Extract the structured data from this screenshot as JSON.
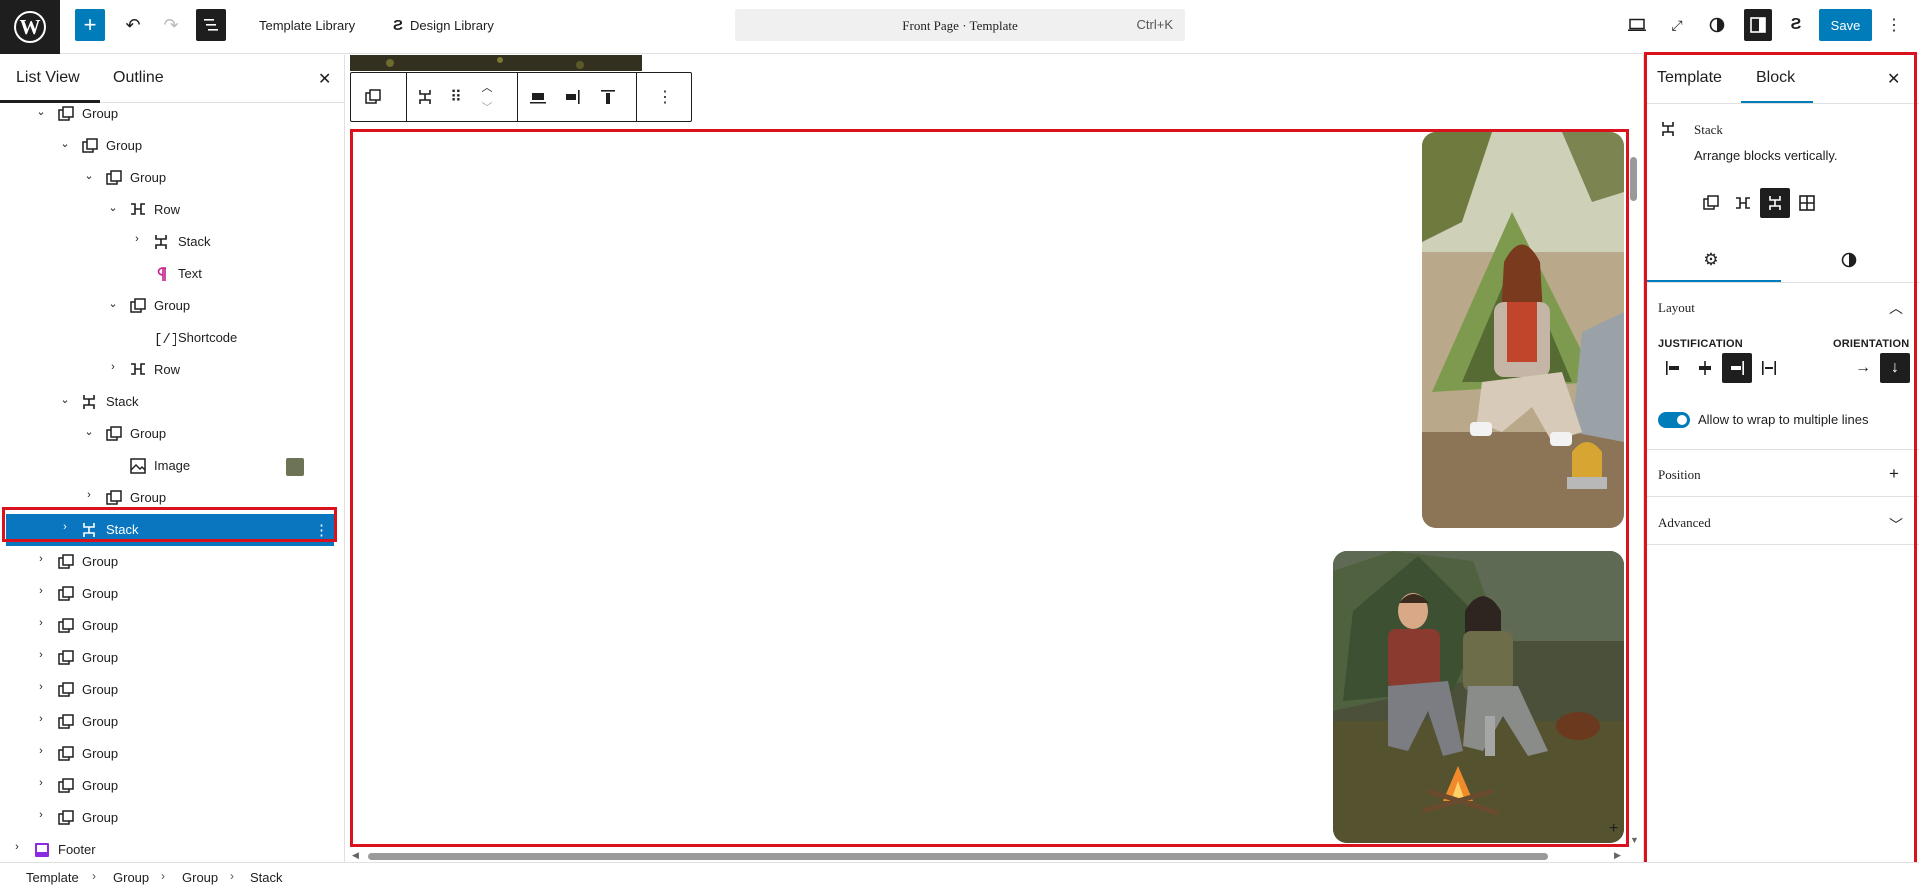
{
  "topbar": {
    "plus_label": "+",
    "undo": "↶",
    "redo": "↷",
    "template_library": "Template Library",
    "design_library": "Design Library",
    "command_title": "Front Page · Template",
    "command_shortcut": "Ctrl+K",
    "save_label": "Save"
  },
  "left_panel": {
    "tabs": [
      "List View",
      "Outline"
    ],
    "close": "✕",
    "rows": [
      {
        "label": "Group",
        "icon": "group-icon",
        "expanded": true
      },
      {
        "label": "Group",
        "icon": "group-icon",
        "expanded": true
      },
      {
        "label": "Group",
        "icon": "group-icon",
        "expanded": true
      },
      {
        "label": "Row",
        "icon": "row-icon",
        "expanded": true
      },
      {
        "label": "Stack",
        "icon": "stack-icon",
        "expanded": false
      },
      {
        "label": "Text",
        "icon": "paragraph-icon"
      },
      {
        "label": "Group",
        "icon": "group-icon",
        "expanded": true
      },
      {
        "label": "Shortcode",
        "icon": "shortcode-icon"
      },
      {
        "label": "Row",
        "icon": "row-icon",
        "expanded": false
      },
      {
        "label": "Stack",
        "icon": "stack-icon",
        "expanded": true
      },
      {
        "label": "Group",
        "icon": "group-icon",
        "expanded": true
      },
      {
        "label": "Image",
        "icon": "image-icon"
      },
      {
        "label": "Group",
        "icon": "group-icon",
        "expanded": false
      },
      {
        "label": "Stack",
        "icon": "stack-icon",
        "expanded": false,
        "selected": true
      },
      {
        "label": "Group",
        "icon": "group-icon",
        "expanded": false
      },
      {
        "label": "Group",
        "icon": "group-icon",
        "expanded": false
      },
      {
        "label": "Group",
        "icon": "group-icon",
        "expanded": false
      },
      {
        "label": "Group",
        "icon": "group-icon",
        "expanded": false
      },
      {
        "label": "Group",
        "icon": "group-icon",
        "expanded": false
      },
      {
        "label": "Group",
        "icon": "group-icon",
        "expanded": false
      },
      {
        "label": "Group",
        "icon": "group-icon",
        "expanded": false
      },
      {
        "label": "Group",
        "icon": "group-icon",
        "expanded": false
      },
      {
        "label": "Group",
        "icon": "group-icon",
        "expanded": false
      },
      {
        "label": "Footer",
        "icon": "footer-icon",
        "expanded": false
      }
    ]
  },
  "breadcrumb": [
    "Template",
    "Group",
    "Group",
    "Stack"
  ],
  "right_panel": {
    "tabs": [
      "Template",
      "Block"
    ],
    "close": "✕",
    "block_title": "Stack",
    "block_desc": "Arrange blocks vertically.",
    "layout_label": "Layout",
    "justification_label": "JUSTIFICATION",
    "orientation_label": "ORIENTATION",
    "wrap_label": "Allow to wrap to multiple lines",
    "position_label": "Position",
    "advanced_label": "Advanced"
  },
  "colors": {
    "accent": "#007cba",
    "selection": "#0a76c0",
    "highlight_frame": "#d9121e",
    "dark": "#1e1e1e"
  }
}
